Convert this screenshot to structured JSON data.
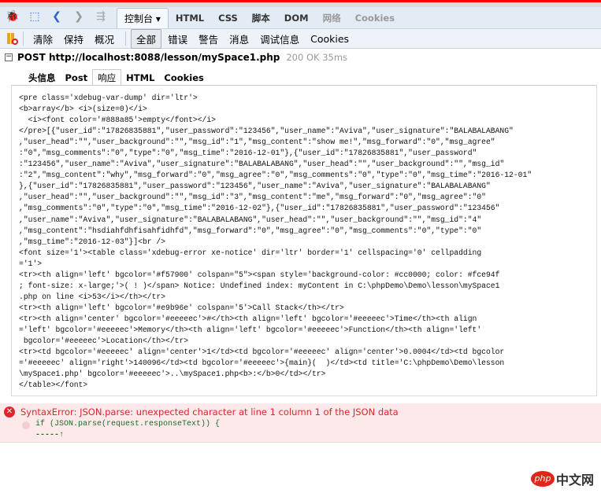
{
  "panel_tabs": [
    {
      "label": "控制台 ▾",
      "active": true
    },
    {
      "label": "HTML"
    },
    {
      "label": "CSS"
    },
    {
      "label": "脚本"
    },
    {
      "label": "DOM"
    },
    {
      "label": "网络",
      "dim": true
    },
    {
      "label": "Cookies",
      "dim": true
    }
  ],
  "filters": {
    "clear": "清除",
    "persist": "保持",
    "profile": "概况",
    "all": "全部",
    "errors": "错误",
    "warnings": "警告",
    "info": "消息",
    "debug": "调试信息",
    "cookies": "Cookies"
  },
  "request": {
    "method_url": "POST http://localhost:8088/lesson/mySpace1.php",
    "status": "200 OK 35ms"
  },
  "response_tabs": [
    "头信息",
    "Post",
    "响应",
    "HTML",
    "Cookies"
  ],
  "response_body": "<pre class='xdebug-var-dump' dir='ltr'>\n<b>array</b> <i>(size=0)</i>\n  <i><font color='#888a85'>empty</font></i>\n</pre>[{\"user_id\":\"17826835881\",\"user_password\":\"123456\",\"user_name\":\"Aviva\",\"user_signature\":\"BALABALABANG\"\n,\"user_head\":\"\",\"user_background\":\"\",\"msg_id\":\"1\",\"msg_content\":\"show me!\",\"msg_forward\":\"0\",\"msg_agree\"\n:\"0\",\"msg_comments\":\"0\",\"type\":\"0\",\"msg_time\":\"2016-12-01\"},{\"user_id\":\"17826835881\",\"user_password\"\n:\"123456\",\"user_name\":\"Aviva\",\"user_signature\":\"BALABALABANG\",\"user_head\":\"\",\"user_background\":\"\",\"msg_id\"\n:\"2\",\"msg_content\":\"why\",\"msg_forward\":\"0\",\"msg_agree\":\"0\",\"msg_comments\":\"0\",\"type\":\"0\",\"msg_time\":\"2016-12-01\"\n},{\"user_id\":\"17826835881\",\"user_password\":\"123456\",\"user_name\":\"Aviva\",\"user_signature\":\"BALABALABANG\"\n,\"user_head\":\"\",\"user_background\":\"\",\"msg_id\":\"3\",\"msg_content\":\"me\",\"msg_forward\":\"0\",\"msg_agree\":\"0\"\n,\"msg_comments\":\"0\",\"type\":\"0\",\"msg_time\":\"2016-12-02\"},{\"user_id\":\"17826835881\",\"user_password\":\"123456\"\n,\"user_name\":\"Aviva\",\"user_signature\":\"BALABALABANG\",\"user_head\":\"\",\"user_background\":\"\",\"msg_id\":\"4\"\n,\"msg_content\":\"hsdiahfdhfisahfidhfd\",\"msg_forward\":\"0\",\"msg_agree\":\"0\",\"msg_comments\":\"0\",\"type\":\"0\"\n,\"msg_time\":\"2016-12-03\"}]<br />\n<font size='1'><table class='xdebug-error xe-notice' dir='ltr' border='1' cellspacing='0' cellpadding\n='1'>\n<tr><th align='left' bgcolor='#f57900' colspan=\"5\"><span style='background-color: #cc0000; color: #fce94f\n; font-size: x-large;'>( ! )</span> Notice: Undefined index: myContent in C:\\phpDemo\\Demo\\lesson\\mySpace1\n.php on line <i>53</i></th></tr>\n<tr><th align='left' bgcolor='#e9b96e' colspan='5'>Call Stack</th></tr>\n<tr><th align='center' bgcolor='#eeeeec'>#</th><th align='left' bgcolor='#eeeeec'>Time</th><th align\n='left' bgcolor='#eeeeec'>Memory</th><th align='left' bgcolor='#eeeeec'>Function</th><th align='left'\n bgcolor='#eeeeec'>Location</th></tr>\n<tr><td bgcolor='#eeeeec' align='center'>1</td><td bgcolor='#eeeeec' align='center'>0.0004</td><td bgcolor\n='#eeeeec' align='right'>140096</td><td bgcolor='#eeeeec'>{main}(  )</td><td title='C:\\phpDemo\\Demo\\lesson\n\\mySpace1.php' bgcolor='#eeeeec'>..\\mySpace1.php<b>:</b>0</td></tr>\n</table></font>",
  "error": {
    "message": "SyntaxError: JSON.parse: unexpected character at line 1 column 1 of the JSON data",
    "code": "if (JSON.parse(request.responseText)) {",
    "caret": "-----↑"
  },
  "watermark": {
    "php": "php",
    "cn": "中文网"
  }
}
